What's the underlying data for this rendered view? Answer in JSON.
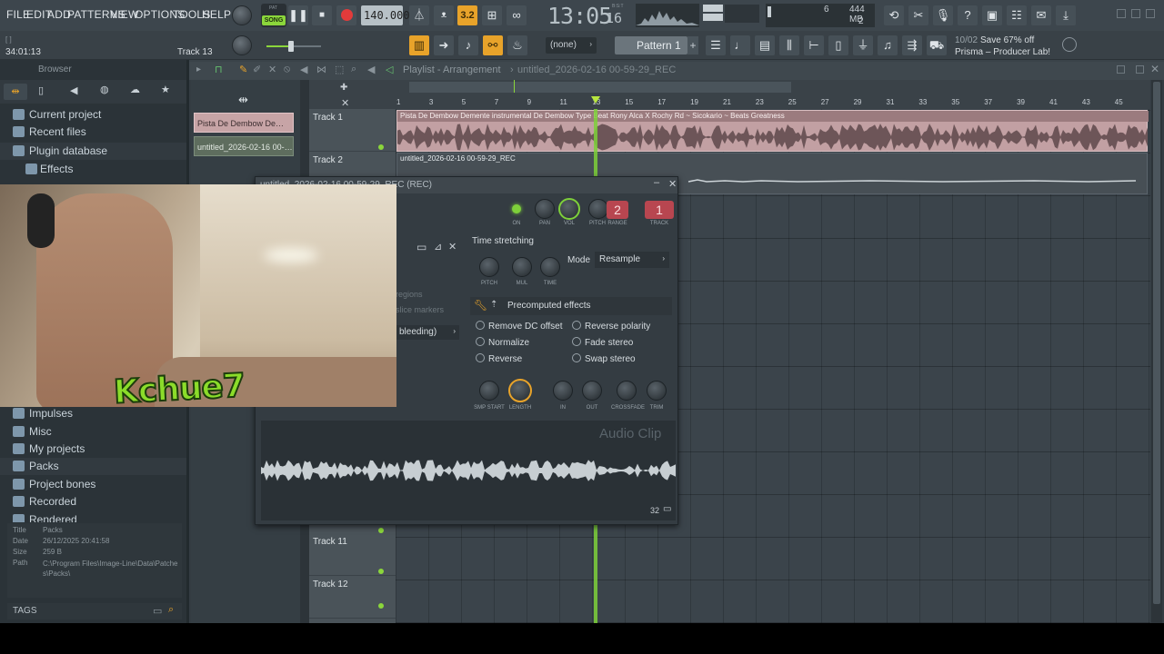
{
  "menu": [
    "FILE",
    "EDIT",
    "ADD",
    "PATTERNS",
    "VIEW",
    "OPTIONS",
    "TOOLS",
    "HELP"
  ],
  "transport": {
    "mode_label": "SONG",
    "pat_label": "PAT",
    "tempo": "140.000",
    "time": "13:05",
    "time_ticks": "16",
    "time_label": "B:S:T"
  },
  "cpu": {
    "value": "6",
    "memory": "444 MB",
    "polyphony": "2"
  },
  "hint_bar": {
    "time": "34:01:13",
    "track": "Track 13"
  },
  "pattern": {
    "name": "Pattern 1",
    "none_label": "(none)"
  },
  "news": {
    "date": "10/02",
    "line1": "Save 67% off",
    "line2": "Prisma – Producer Lab!"
  },
  "browser": {
    "title": "Browser",
    "items": [
      "Current project",
      "Recent files",
      "Plugin database",
      "Effects"
    ],
    "items_lower": [
      "Impulses",
      "Misc",
      "My projects",
      "Packs",
      "Project bones",
      "Recorded",
      "Rendered"
    ],
    "info": {
      "Title": "Packs",
      "Date": "26/12/2025 20:41:58",
      "Size": "259 B",
      "Path": "C:\\Program Files\\Image-Line\\Data\\Patches\\Packs\\"
    },
    "tags_label": "TAGS"
  },
  "playlist": {
    "title": "Playlist - Arrangement",
    "crumb": "untitled_2026-02-16 00-59-29_REC",
    "ruler": [
      "1",
      "3",
      "5",
      "7",
      "9",
      "11",
      "13",
      "15",
      "17",
      "19",
      "21",
      "23",
      "25",
      "27",
      "29",
      "31",
      "33",
      "35",
      "37",
      "39",
      "41",
      "43",
      "45"
    ],
    "tracks": [
      "Track 1",
      "Track 2",
      "Track 11",
      "Track 12"
    ],
    "clips": [
      "Pista De Dembow De…",
      "untitled_2026-02-16 00-…"
    ],
    "clip1_title": "Pista De Dembow Demente instrumental De Dembow Type Beat Rony Alca X Rochy Rd ~ Sicokario ~ Beats Greatness",
    "clip2_title": "untitled_2026-02-16 00-59-29_REC"
  },
  "plugin": {
    "title": "untitled_2026-02-16 00-59-29_REC (REC)",
    "knob_labels": [
      "ON",
      "PAN",
      "VOL",
      "PITCH",
      "RANGE",
      "TRACK"
    ],
    "range_value": "2",
    "track_value": "1",
    "time_stretching": "Time stretching",
    "ts_labels": [
      "PITCH",
      "MUL",
      "TIME"
    ],
    "mode_label": "Mode",
    "mode_value": "Resample",
    "precomputed": "Precomputed effects",
    "effects_left": [
      "Remove DC offset",
      "Normalize",
      "Reverse"
    ],
    "effects_right": [
      "Reverse polarity",
      "Fade stereo",
      "Swap stereo"
    ],
    "bottom_knobs": [
      "SMP START",
      "LENGTH",
      "IN",
      "OUT",
      "CROSSFADE",
      "TRIM"
    ],
    "left_faded": [
      "regions",
      "slice markers"
    ],
    "bleeding": "bleeding)",
    "clip_label": "Audio Clip",
    "zoom_value": "32"
  },
  "webcam": {
    "overlay_text": "Kchue7"
  }
}
